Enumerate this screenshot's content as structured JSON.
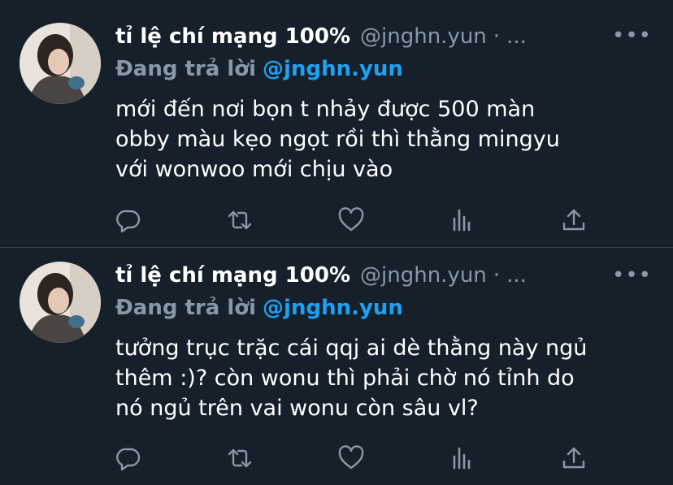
{
  "tweets": [
    {
      "name": "tỉ lệ chí mạng 100%",
      "handle": "@jnghn.yun",
      "dot": "·",
      "overflow": "...",
      "more": "•••",
      "reply_label": "Đang trả lời",
      "reply_mention": "@jnghn.yun",
      "lines": [
        "mới đến nơi bọn t nhảy được 500 màn",
        "obby màu kẹo ngọt rồi thì thằng mingyu",
        "với wonwoo mới chịu vào"
      ]
    },
    {
      "name": "tỉ lệ chí mạng 100%",
      "handle": "@jnghn.yun",
      "dot": "·",
      "overflow": "...",
      "more": "•••",
      "reply_label": "Đang trả lời",
      "reply_mention": "@jnghn.yun",
      "lines": [
        "tưởng trục trặc cái qqj ai dè thằng này ngủ",
        "thêm :)? còn wonu thì phải chờ nó tỉnh do",
        "nó ngủ trên vai wonu còn sâu vl?"
      ]
    }
  ],
  "icons": {
    "reply": "reply-icon",
    "retweet": "retweet-icon",
    "like": "heart-icon",
    "analytics": "analytics-icon",
    "share": "share-icon"
  },
  "colors": {
    "background": "#15202b",
    "divider": "#38444d",
    "secondary_text": "#8899a6",
    "mention": "#1da1f2"
  }
}
